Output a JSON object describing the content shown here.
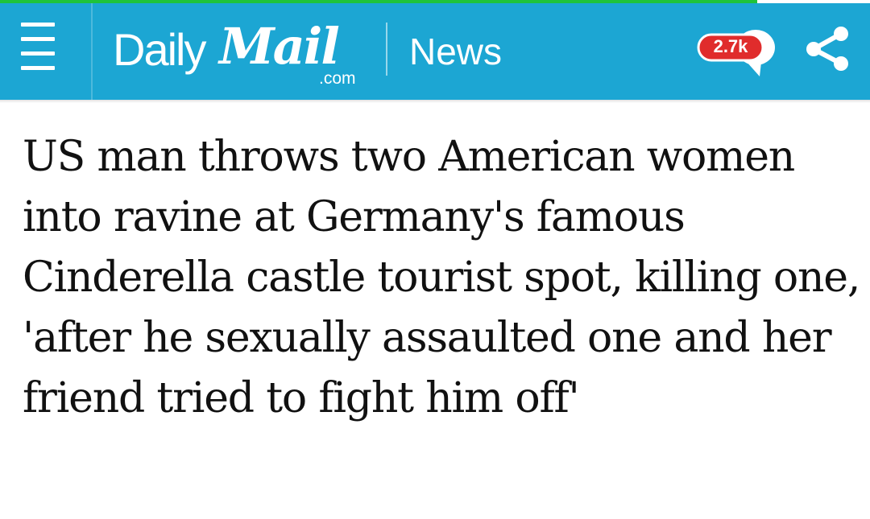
{
  "header": {
    "logo": {
      "daily": "Daily",
      "mail": "Mail",
      "com": ".com"
    },
    "section": "News",
    "comment_count": "2.7k",
    "menu_icon": "hamburger-menu-icon",
    "comment_icon": "speech-bubble-icon",
    "share_icon": "share-icon"
  },
  "article": {
    "headline": "US man throws two American women into ravine at Germany's famous Cinderella castle tourist spot, killing one, 'after he sexually assaulted one and her friend tried to fight him off'"
  },
  "colors": {
    "header_bg": "#1ca6d3",
    "load_bar": "#1fc33b",
    "comment_badge": "#e02c2c",
    "text": "#111111"
  }
}
